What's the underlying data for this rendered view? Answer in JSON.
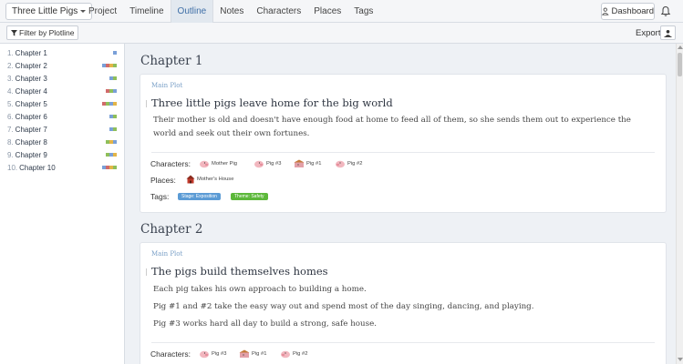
{
  "header": {
    "project_name": "Three Little Pigs",
    "nav": [
      "Project",
      "Timeline",
      "Outline",
      "Notes",
      "Characters",
      "Places",
      "Tags"
    ],
    "active_nav": "Outline",
    "dashboard_label": "Dashboard"
  },
  "toolbar": {
    "filter_label": "Filter by Plotline",
    "export_label": "Export:"
  },
  "sidebar": {
    "chapters": [
      {
        "num": "1.",
        "label": "Chapter 1",
        "colors": [
          "#7aa0d8"
        ]
      },
      {
        "num": "2.",
        "label": "Chapter 2",
        "colors": [
          "#7aa0d8",
          "#d16b6b",
          "#e3b548",
          "#8fbf5a"
        ]
      },
      {
        "num": "3.",
        "label": "Chapter 3",
        "colors": [
          "#7aa0d8",
          "#8fbf5a"
        ]
      },
      {
        "num": "4.",
        "label": "Chapter 4",
        "colors": [
          "#d16b6b",
          "#8fbf5a",
          "#7aa0d8"
        ]
      },
      {
        "num": "5.",
        "label": "Chapter 5",
        "colors": [
          "#d16b6b",
          "#8fbf5a",
          "#7aa0d8",
          "#e3b548"
        ]
      },
      {
        "num": "6.",
        "label": "Chapter 6",
        "colors": [
          "#7aa0d8",
          "#8fbf5a"
        ]
      },
      {
        "num": "7.",
        "label": "Chapter 7",
        "colors": [
          "#7aa0d8",
          "#8fbf5a"
        ]
      },
      {
        "num": "8.",
        "label": "Chapter 8",
        "colors": [
          "#8fbf5a",
          "#e3b548",
          "#7aa0d8"
        ]
      },
      {
        "num": "9.",
        "label": "Chapter 9",
        "colors": [
          "#8fbf5a",
          "#7aa0d8",
          "#e3b548"
        ]
      },
      {
        "num": "10.",
        "label": "Chapter 10",
        "colors": [
          "#7aa0d8",
          "#d16b6b",
          "#e3b548",
          "#8fbf5a"
        ]
      }
    ]
  },
  "main": {
    "chapters": [
      {
        "title": "Chapter 1",
        "plotline": "Main Plot",
        "scene_title": "Three little pigs leave home for the big world",
        "paragraphs": [
          "Their mother is old and doesn't have enough food at home to feed all of them, so she sends them out to experience the world and seek out their own fortunes."
        ],
        "characters_label": "Characters:",
        "characters": [
          "Mother Pig",
          "Pig #3",
          "Pig #1",
          "Pig #2"
        ],
        "places_label": "Places:",
        "places": [
          "Mother's House"
        ],
        "tags_label": "Tags:",
        "tags": [
          {
            "label": "Stage: Exposition",
            "color": "#5b9bd5"
          },
          {
            "label": "Theme: Safety",
            "color": "#5cb83a"
          }
        ]
      },
      {
        "title": "Chapter 2",
        "plotline": "Main Plot",
        "scene_title": "The pigs build themselves homes",
        "paragraphs": [
          "Each pig takes his own approach to building a home.",
          "Pig #1 and #2 take the easy way out and spend most of the day singing, dancing, and playing.",
          "Pig #3 works hard all day to build a strong, safe house."
        ],
        "characters_label": "Characters:",
        "characters": [
          "Pig #3",
          "Pig #1",
          "Pig #2"
        ]
      }
    ]
  },
  "icons": {
    "project_caret": "chevron-down-icon",
    "dashboard": "user-icon",
    "notifications": "bell-icon",
    "filter": "funnel-icon",
    "export": "export-icon"
  }
}
